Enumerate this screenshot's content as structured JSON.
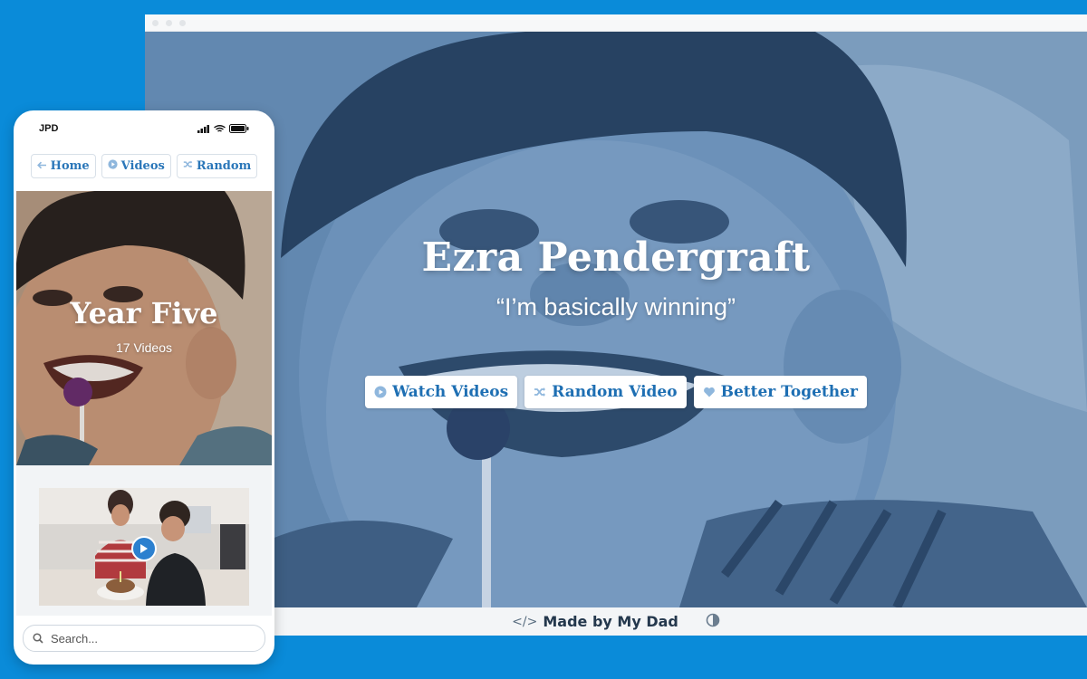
{
  "desktop": {
    "hero": {
      "title": "Ezra Pendergraft",
      "quote": "“I’m basically winning”",
      "buttons": [
        {
          "label": "Watch Videos",
          "icon": "play-circle-icon"
        },
        {
          "label": "Random Video",
          "icon": "shuffle-icon"
        },
        {
          "label": "Better Together",
          "icon": "heart-icon"
        }
      ]
    },
    "footer": {
      "credit": "Made by My Dad",
      "credit_icon": "code-icon",
      "theme_icon": "contrast-icon"
    }
  },
  "phone": {
    "status": {
      "carrier": "JPD"
    },
    "nav": [
      {
        "label": "Home",
        "icon": "back-arrow-icon"
      },
      {
        "label": "Videos",
        "icon": "play-circle-icon"
      },
      {
        "label": "Random",
        "icon": "shuffle-icon"
      }
    ],
    "year": {
      "title": "Year Five",
      "count": "17 Videos"
    },
    "search": {
      "placeholder": "Search..."
    }
  },
  "colors": {
    "background": "#0a8bd9",
    "accent": "#1e6fb3",
    "hero_tint": "#5a84ab"
  }
}
